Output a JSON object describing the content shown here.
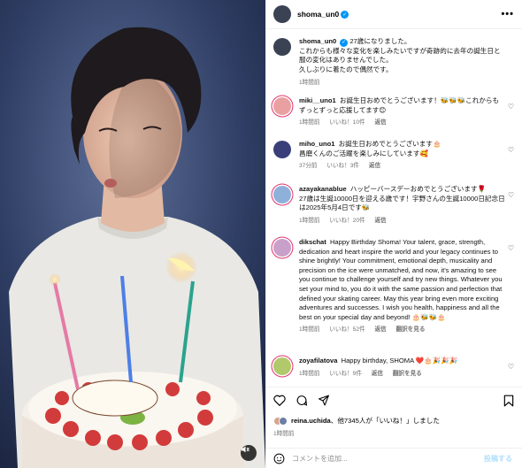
{
  "post": {
    "username": "shoma_un0",
    "more_label": "•••"
  },
  "caption": {
    "username": "shoma_un0",
    "text": "27歳になりました。\nこれからも様々な変化を楽しみたいですが奇跡的に去年の誕生日と服の変化はありませんでした。\n久しぶりに着たので偶然です。",
    "time": "1時間前"
  },
  "comments": [
    {
      "username": "miki__uno1",
      "text": "お誕生日おめでとうございます！🐝🐝🐝これからもずっとずっと応援してます😊",
      "time": "1時間前",
      "likes": "いいね！10件",
      "reply": "返信"
    },
    {
      "username": "miho_uno1",
      "text": "お誕生日おめでとうございます🎂\n昌磨くんのご活躍を楽しみにしています🥰",
      "time": "37分前",
      "likes": "いいね！3件",
      "reply": "返信"
    },
    {
      "username": "azayakanablue",
      "text": "ハッピーバースデーおめでとうございます🌹\n27歳は生誕10000日を迎える歳です！宇野さんの生誕10000日記念日は2025年5月4日です🐝",
      "time": "1時間前",
      "likes": "いいね！20件",
      "reply": "返信"
    },
    {
      "username": "dikschat",
      "text": "Happy Birthday Shoma! Your talent, grace, strength, dedication and heart inspire the world and your legacy continues to shine brightly! Your commitment, emotional depth, musicality and precision on the ice were unmatched, and now, it's amazing to see you continue to challenge yourself and try new things. Whatever you set your mind to, you do it with the same passion and perfection that defined your skating career. May this year bring even more exciting adventures and successes. I wish you health, happiness and all the best on your special day and beyond! 🎂🐝🐝🎂",
      "time": "1時間前",
      "likes": "いいね！52件",
      "reply": "返信",
      "translate": "翻訳を見る"
    },
    {
      "username": "zoyafilatova",
      "text": "Happy birthday, SHOMA ❤️🎂🎉🎉🎉",
      "time": "1時間前",
      "likes": "いいね！9件",
      "reply": "返信",
      "translate": "翻訳を見る"
    }
  ],
  "likes_line": {
    "username": "reina.uchida",
    "rest": "、他7345人が「いいね！」しました"
  },
  "post_time": "1時間前",
  "add_comment": {
    "placeholder": "コメントを追加...",
    "post_label": "投稿する"
  },
  "colors": {
    "verified": "#0095f6",
    "story_ring": "#e1306c",
    "post_button_disabled": "#b2dffc"
  },
  "icons": [
    "verified-icon",
    "more-icon",
    "heart-icon",
    "comment-icon",
    "share-icon",
    "bookmark-icon",
    "emoji-icon",
    "mute-icon"
  ]
}
